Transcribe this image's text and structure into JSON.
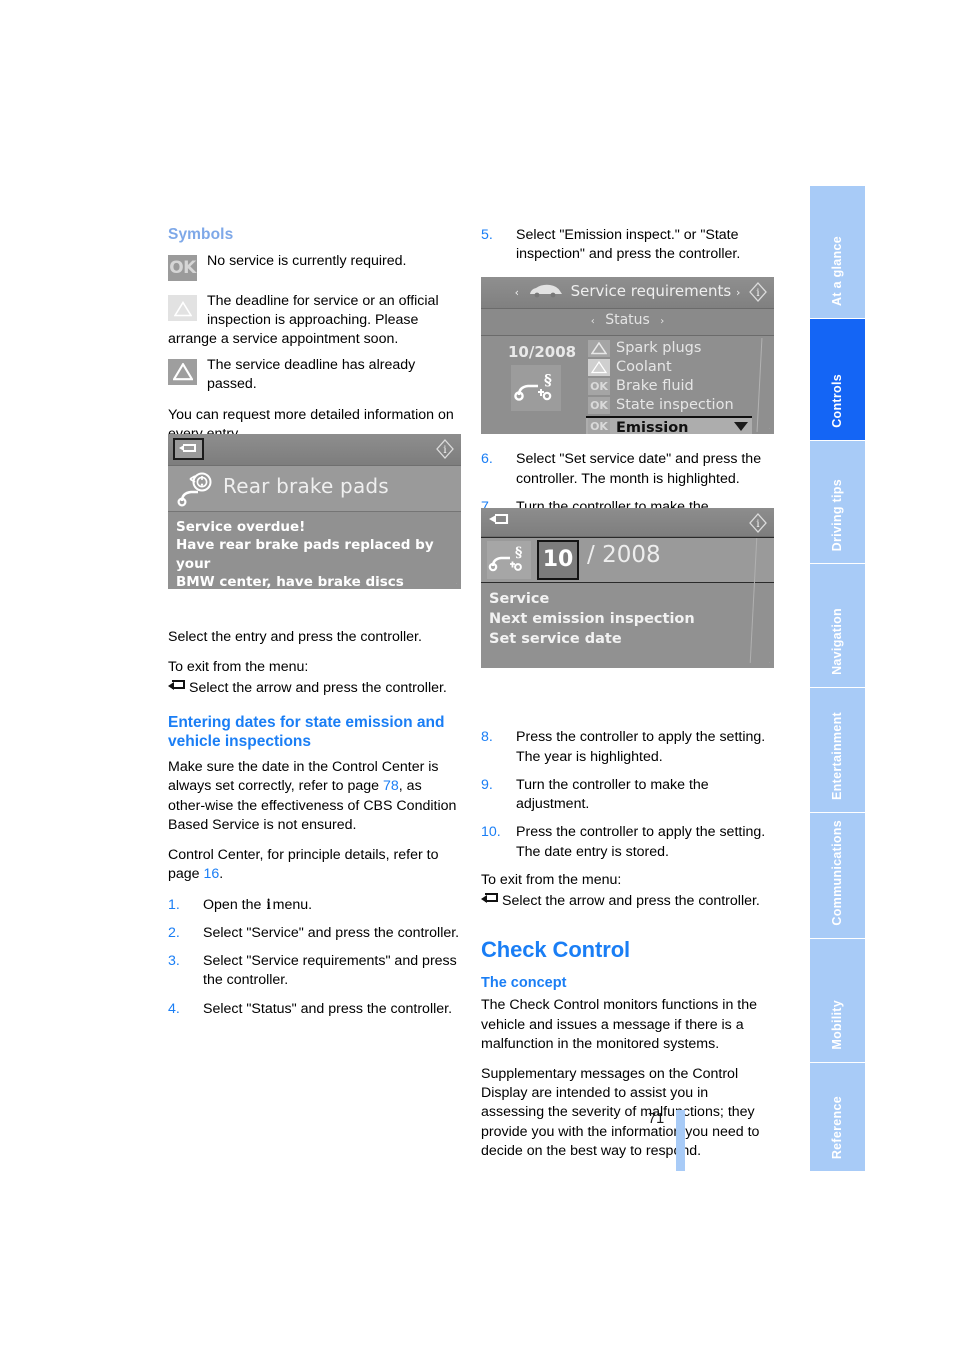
{
  "page": {
    "number": "71"
  },
  "sidebar": {
    "tabs": [
      {
        "label": "At a glance",
        "active": false
      },
      {
        "label": "Controls",
        "active": true
      },
      {
        "label": "Driving tips",
        "active": false
      },
      {
        "label": "Navigation",
        "active": false
      },
      {
        "label": "Entertainment",
        "active": false
      },
      {
        "label": "Communications",
        "active": false
      },
      {
        "label": "Mobility",
        "active": false
      },
      {
        "label": "Reference",
        "active": false
      }
    ],
    "colors": {
      "inactive": "#a8cbf7",
      "active": "#1465f5",
      "label": "#ffffff"
    }
  },
  "colors": {
    "heading_blue": "#1a7ef5",
    "heading_pale_blue": "#7ea8e8",
    "link_blue": "#1a7ef5",
    "screen_grey": "#8c8c8c"
  },
  "left_column": {
    "symbols_heading": "Symbols",
    "symbols": [
      {
        "icon": "ok-badge-icon",
        "icon_text": "OK",
        "text": "No service is currently required."
      },
      {
        "icon": "warning-triangle-light-icon",
        "icon_text": "",
        "text": "The deadline for service or an official inspection is approaching. Please",
        "continuation": "arrange a service appointment soon."
      },
      {
        "icon": "warning-triangle-dark-icon",
        "icon_text": "",
        "text": "The service deadline has already passed."
      }
    ],
    "paragraph_more_info": "You can request more detailed information on every entry.",
    "screenshot_brake": {
      "name": "idrive-rear-brake-pads-screen",
      "back_button": "back-arrow-button",
      "info_button": "info-button",
      "entry_title": "Rear brake pads",
      "message_lines": [
        "Service overdue!",
        "Have rear brake pads replaced by your",
        "BMW center, have brake discs checked"
      ]
    },
    "after_screenshot_1": "Select the entry and press the controller.",
    "exit_menu_label": "To exit from the menu:",
    "exit_menu_action": "Select the arrow and press the controller.",
    "entering_dates_heading": "Entering dates for state emission and vehicle inspections",
    "paragraph_make_sure_a": "Make sure the date in the Control Center is always set correctly, refer to page ",
    "paragraph_make_sure_page": "78",
    "paragraph_make_sure_b": ", as other-wise the effectiveness of CBS Condition Based Service is not ensured.",
    "paragraph_control_center_a": "Control Center, for principle details, refer to page ",
    "paragraph_control_center_page": "16",
    "paragraph_control_center_b": ".",
    "steps": [
      {
        "num": "1.",
        "text_before": "Open the ",
        "glyph": "i",
        "text_after": "menu."
      },
      {
        "num": "2.",
        "text": "Select \"Service\" and press the controller."
      },
      {
        "num": "3.",
        "text": "Select \"Service requirements\" and press the controller."
      },
      {
        "num": "4.",
        "text": "Select \"Status\" and press the controller."
      }
    ]
  },
  "right_column": {
    "step5": {
      "num": "5.",
      "text": "Select \"Emission inspect.\" or \"State inspection\" and press the controller."
    },
    "screenshot_status": {
      "name": "idrive-service-requirements-status-screen",
      "breadcrumb_title": "Service requirements",
      "breadcrumb_left_arrow": "‹",
      "breadcrumb_right_arrow": "›",
      "car_icon": "car-icon",
      "info_button": "info-button",
      "sub_title": "Status",
      "date_label": "10/2008",
      "big_icon": "service-inspection-icon",
      "items": [
        {
          "status": "warn-dark",
          "status_text": "",
          "label": "Spark plugs",
          "selected": false
        },
        {
          "status": "warn-light",
          "status_text": "",
          "label": "Coolant",
          "selected": false
        },
        {
          "status": "ok",
          "status_text": "OK",
          "label": "Brake fluid",
          "selected": false
        },
        {
          "status": "ok",
          "status_text": "OK",
          "label": "State inspection",
          "selected": false
        },
        {
          "status": "ok",
          "status_text": "OK",
          "label": "Emission inspect.",
          "selected": true
        }
      ]
    },
    "step6": {
      "num": "6.",
      "text": "Select \"Set service date\" and press the controller. The month is highlighted."
    },
    "step7": {
      "num": "7.",
      "text": "Turn the controller to make the adjustment."
    },
    "screenshot_date": {
      "name": "idrive-set-service-date-screen",
      "back_button": "back-arrow-button",
      "info_button": "info-button",
      "service_icon": "service-inspection-icon",
      "month": "10",
      "separator": "/",
      "year": "2008",
      "menu_items": [
        "Service",
        "Next emission inspection",
        "Set service date"
      ]
    },
    "step8": {
      "num": "8.",
      "text": "Press the controller to apply the setting. The year is highlighted."
    },
    "step9": {
      "num": "9.",
      "text": "Turn the controller to make the adjustment."
    },
    "step10": {
      "num": "10.",
      "text": "Press the controller to apply the setting. The date entry is stored."
    },
    "exit_menu_label": "To exit from the menu:",
    "exit_menu_action": "Select the arrow and press the controller.",
    "chapter_heading": "Check Control",
    "concept_heading": "The concept",
    "concept_paragraph_1": "The Check Control monitors functions in the vehicle and issues a message if there is a malfunction in the monitored systems.",
    "concept_paragraph_2": "Supplementary messages on the Control Display are intended to assist you in assessing the severity of malfunctions; they provide you with the information you need to decide on the best way to respond."
  }
}
